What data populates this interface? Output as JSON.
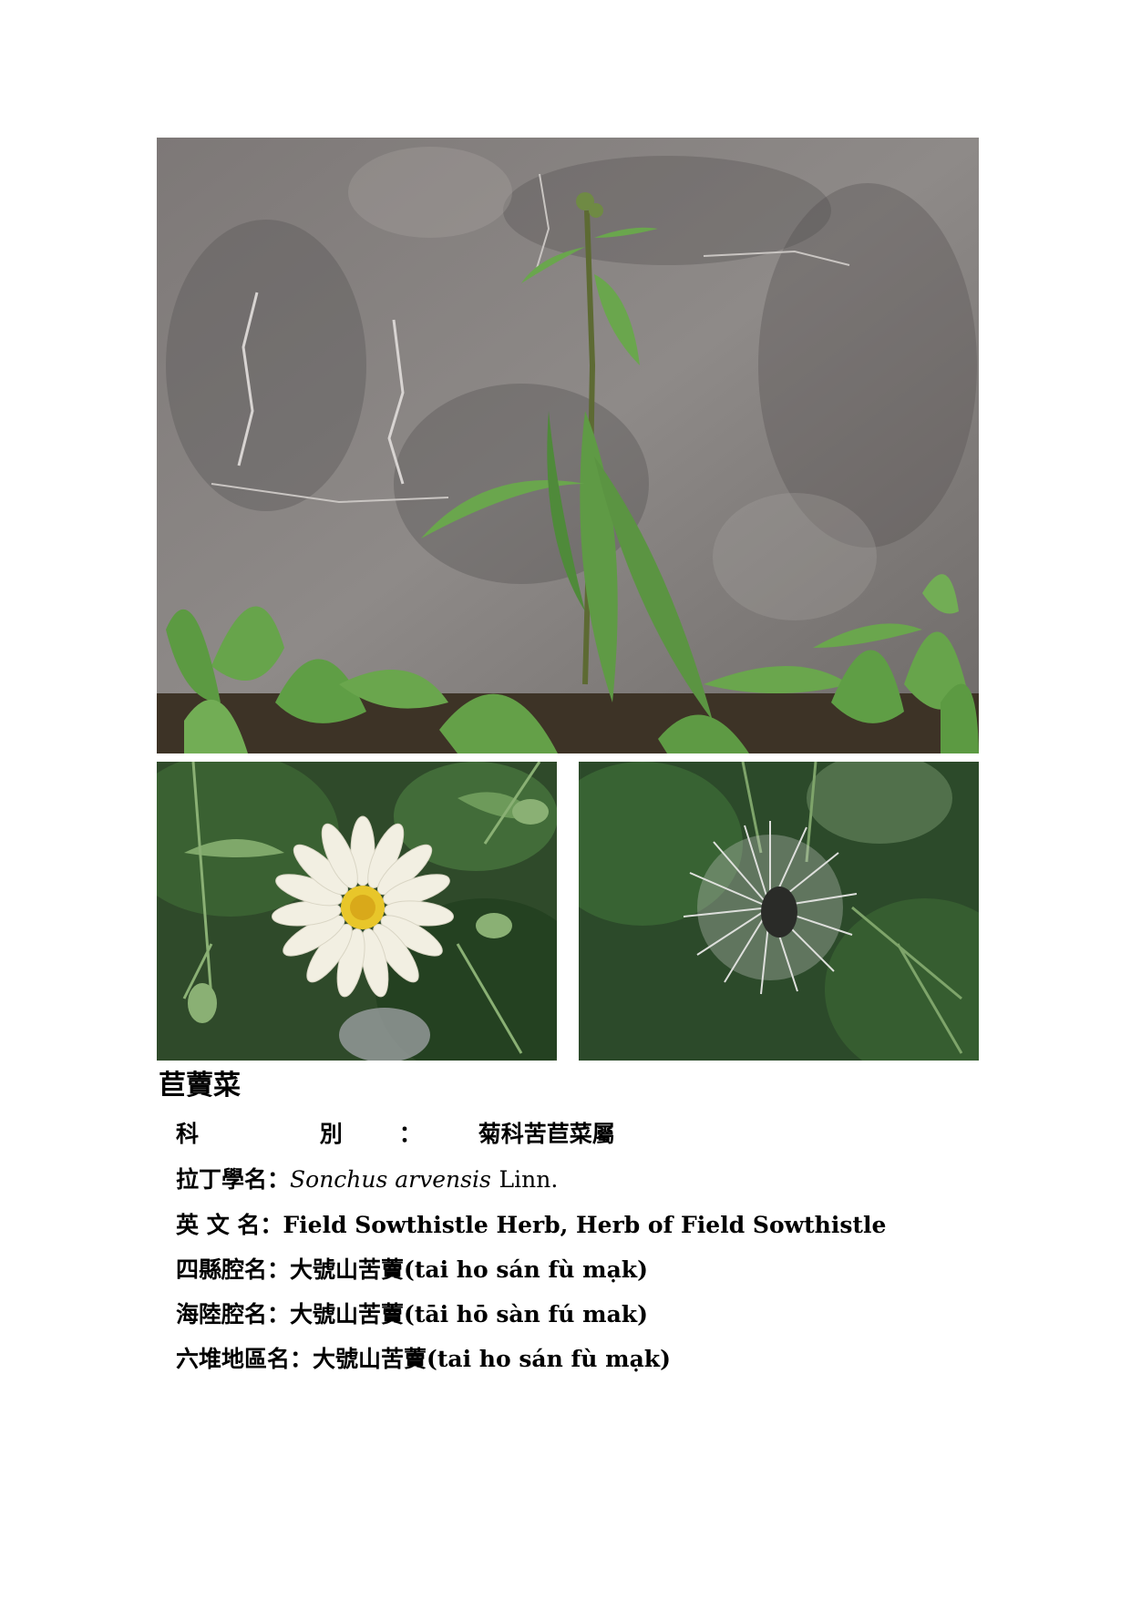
{
  "photos": {
    "main": {
      "icon": "wall-plant-photo"
    },
    "flower": {
      "icon": "white-flower-photo"
    },
    "seedhead": {
      "icon": "seedhead-photo"
    }
  },
  "title": "苣藚菜",
  "info": {
    "family": {
      "label": "科 別：",
      "value": "菊科苦苣菜屬"
    },
    "latin": {
      "label": "拉丁學名：",
      "genus_species": "Sonchus arvensis",
      "author": "Linn."
    },
    "english": {
      "label": "英 文 名：",
      "value": "Field Sowthistle Herb, Herb of Field Sowthistle"
    },
    "sixian": {
      "label": "四縣腔名：",
      "name": "大號山苦藚",
      "pron": "(tai ho sán fù mạk)"
    },
    "hailu": {
      "label": "海陸腔名：",
      "name": "大號山苦藚",
      "pron": "(tāi hō sàn fú mak)"
    },
    "liudui": {
      "label": "六堆地區名：",
      "name": "大號山苦藚",
      "pron": "(tai ho sán fù mạk)"
    }
  }
}
